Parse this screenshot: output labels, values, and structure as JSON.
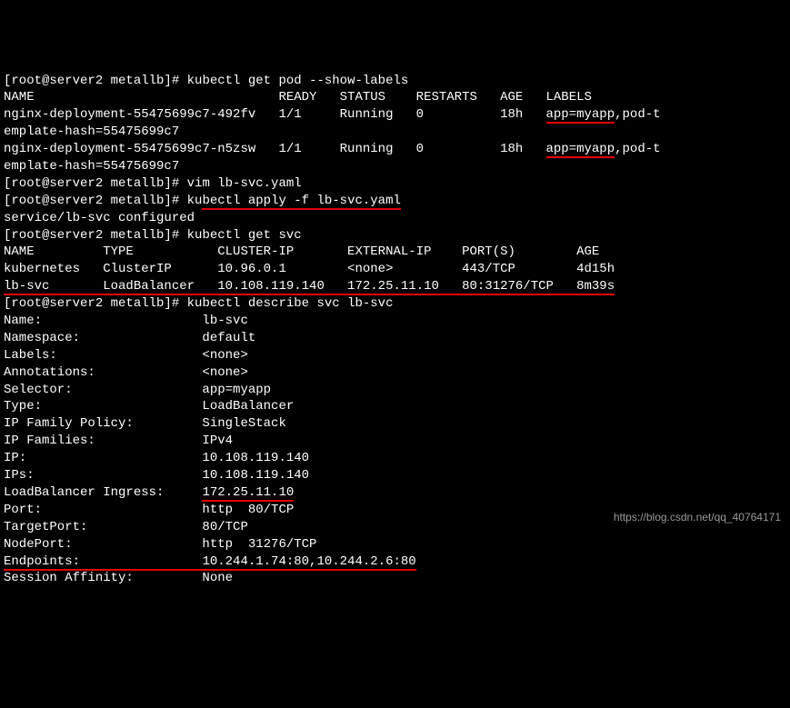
{
  "prompt": "[root@server2 metallb]# ",
  "cmd1": "kubectl get pod --show-labels",
  "pods_header": "NAME                                READY   STATUS    RESTARTS   AGE   LABELS",
  "pod1_pre": "nginx-deployment-55475699c7-492fv   1/1     Running   0          18h   ",
  "pod1_app": "app=myapp",
  "pod1_post": ",pod-t",
  "pod_hash": "emplate-hash=55475699c7",
  "pod2_pre": "nginx-deployment-55475699c7-n5zsw   1/1     Running   0          18h   ",
  "pod2_app": "app=myapp",
  "pod2_post": ",pod-t",
  "cmd2": "vim lb-svc.yaml",
  "cmd3_pre": "ku",
  "cmd3_mid": "bectl apply -f lb-svc.yaml",
  "svc_configured": "service/lb-svc configured",
  "cmd4": "kubectl get svc",
  "svc_header": "NAME         TYPE           CLUSTER-IP       EXTERNAL-IP    PORT(S)        AGE",
  "svc_k8s": "kubernetes   ClusterIP      10.96.0.1        <none>         443/TCP        4d15h",
  "svc_lb_pre": "lb-svc       LoadBalancer   10.108.119.140   172.25.11.10   80:31276/TCP   8m39s",
  "cmd5": "kubectl describe svc lb-svc",
  "d_name": "Name:                     lb-svc",
  "d_ns": "Namespace:                default",
  "d_labels": "Labels:                   <none>",
  "d_anno": "Annotations:              <none>",
  "d_selector": "Selector:                 app=myapp",
  "d_type": "Type:                     LoadBalancer",
  "d_ipfp": "IP Family Policy:         SingleStack",
  "d_ipf": "IP Families:              IPv4",
  "d_ip": "IP:                       10.108.119.140",
  "d_ips": "IPs:                      10.108.119.140",
  "d_lbi_pre": "LoadBalancer Ingress:     ",
  "d_lbi_val": "172.25.11.10",
  "d_port": "Port:                     http  80/TCP",
  "d_tport": "TargetPort:               80/TCP",
  "d_nport": "NodePort:                 http  31276/TCP",
  "d_ep_pre": "Endpoints:                ",
  "d_ep_val": "10.244.1.74:80,10.244.2.6:80",
  "d_sa": "Session Affinity:         None",
  "watermark": "https://blog.csdn.net/qq_40764171"
}
